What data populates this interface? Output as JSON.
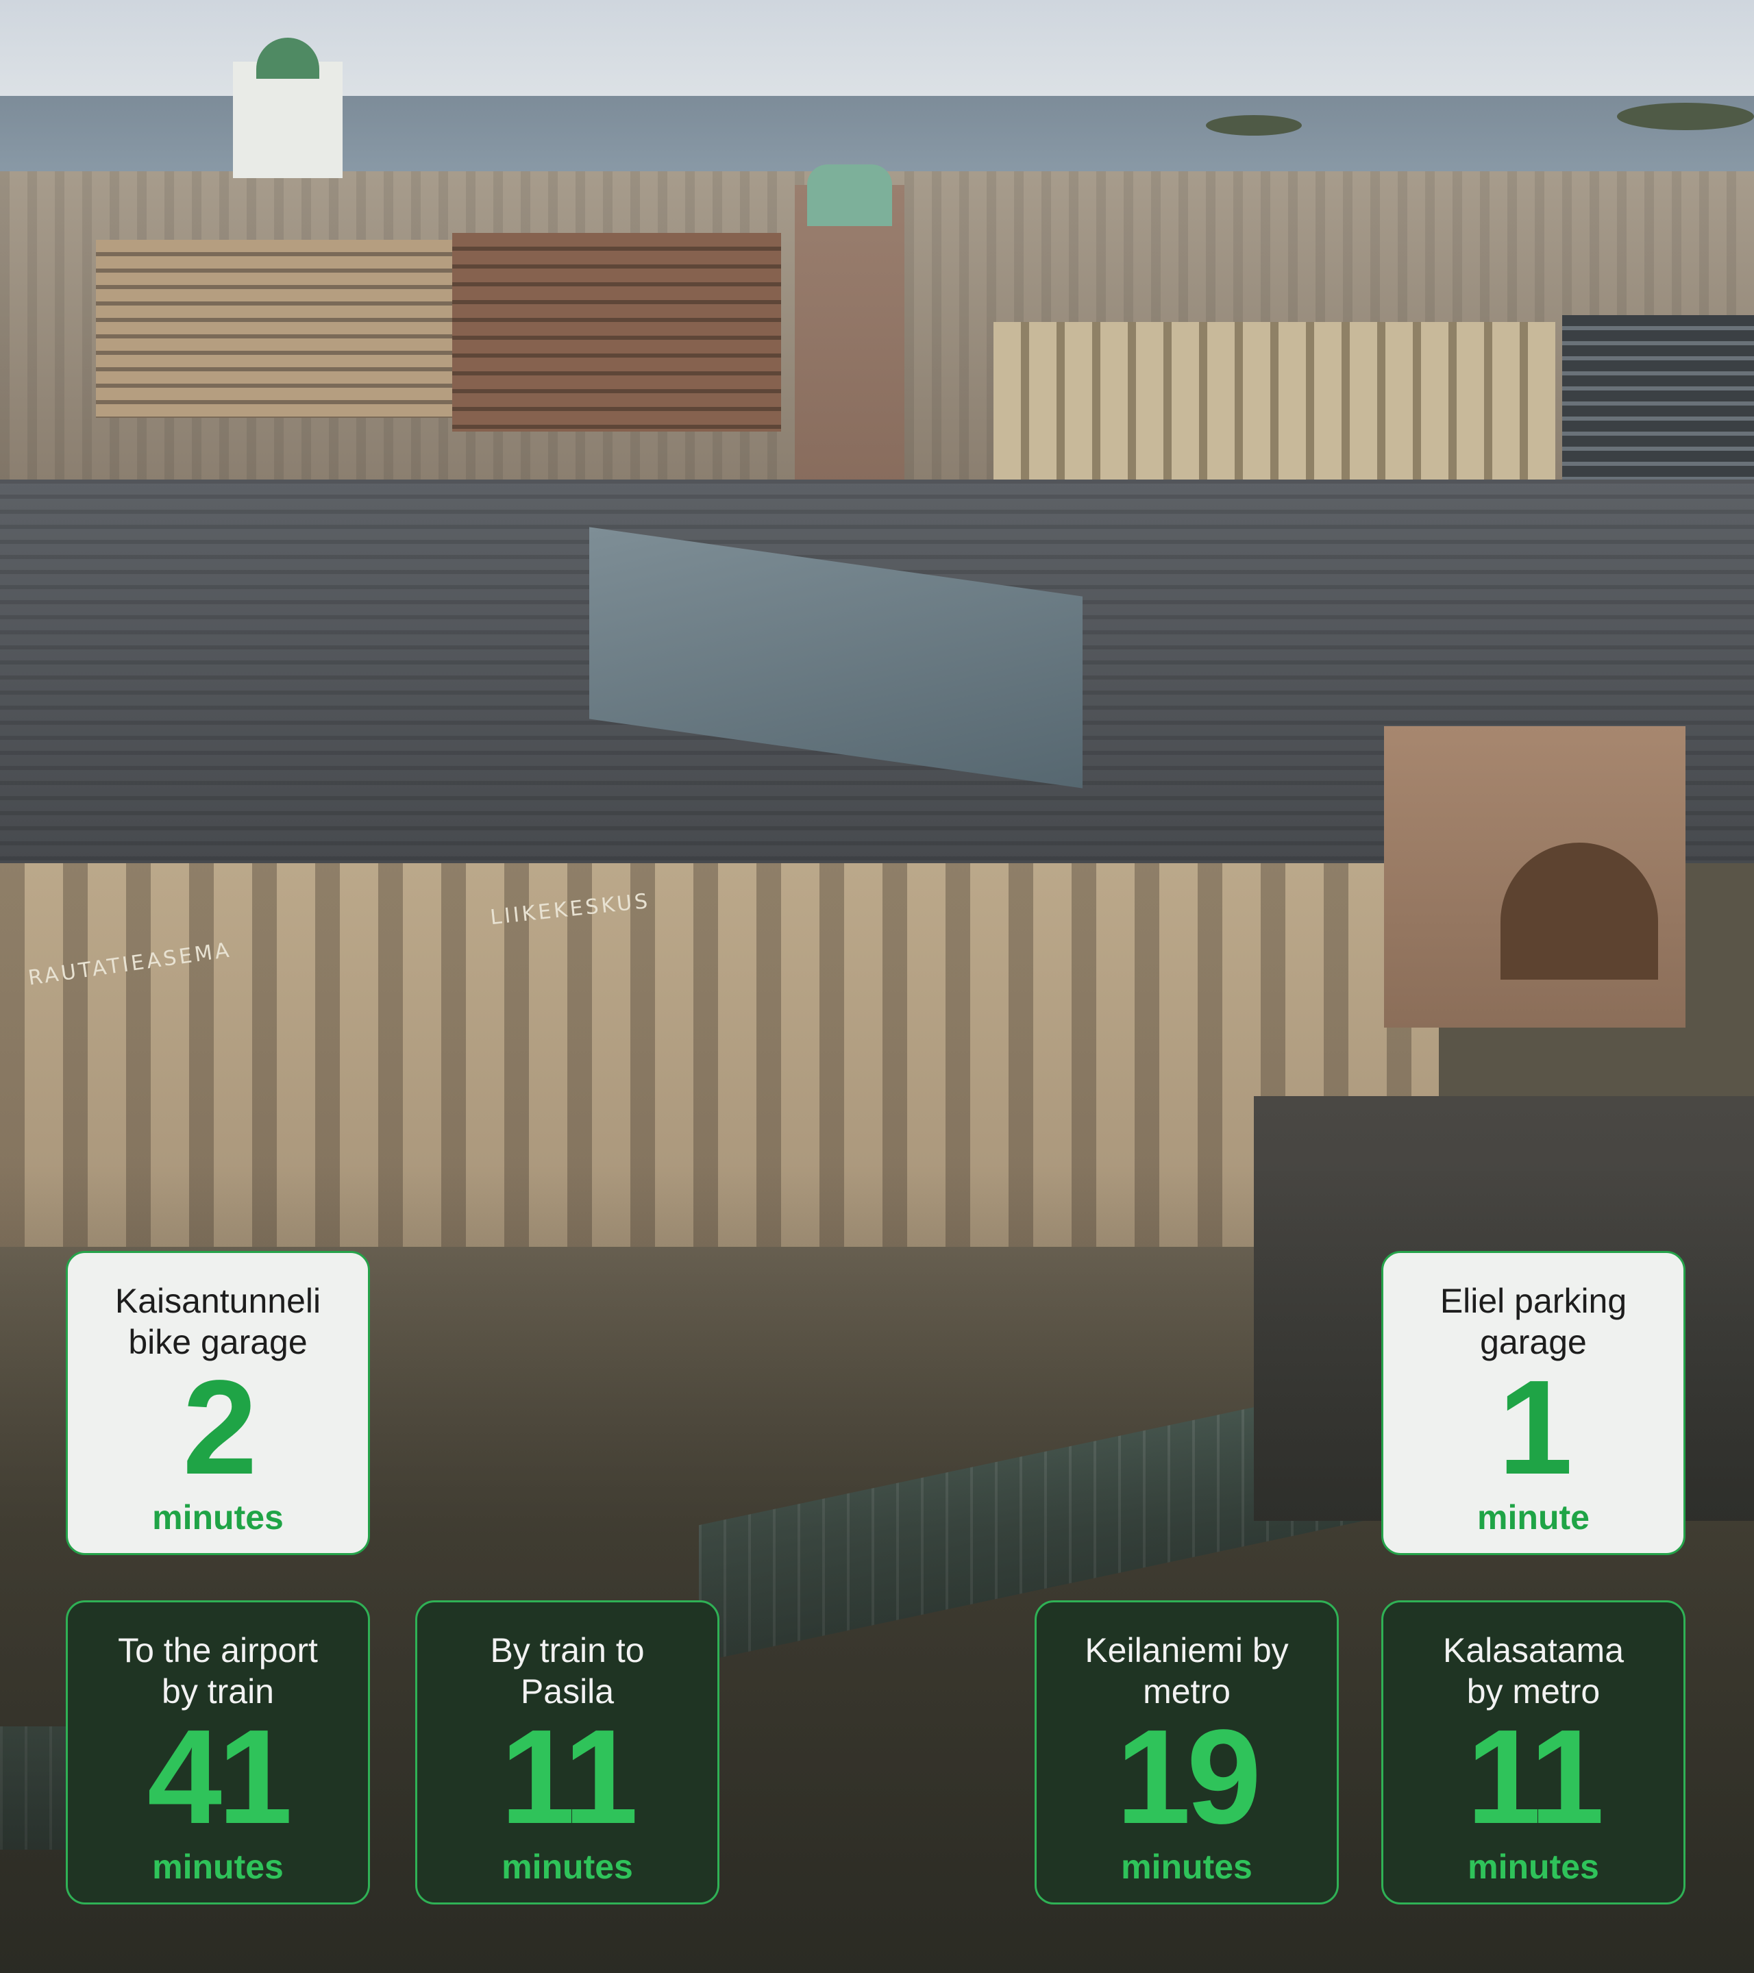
{
  "cards": [
    {
      "title": "Kaisantunneli\nbike garage",
      "value": "2",
      "unit": "minutes"
    },
    {
      "title": "Eliel parking\ngarage",
      "value": "1",
      "unit": "minute"
    },
    {
      "title": "To the airport\nby train",
      "value": "41",
      "unit": "minutes"
    },
    {
      "title": "By train to\nPasila",
      "value": "11",
      "unit": "minutes"
    },
    {
      "title": "Keilaniemi by\nmetro",
      "value": "19",
      "unit": "minutes"
    },
    {
      "title": "Kalasatama\nby metro",
      "value": "11",
      "unit": "minutes"
    }
  ],
  "photo": {
    "station_signs": [
      "RAUTATIEASEMA",
      "LIIKEKESKUS"
    ]
  },
  "colors": {
    "accent_green": "#1fa446",
    "dark_card": "#1f3423",
    "light_card": "#eff1ef"
  }
}
